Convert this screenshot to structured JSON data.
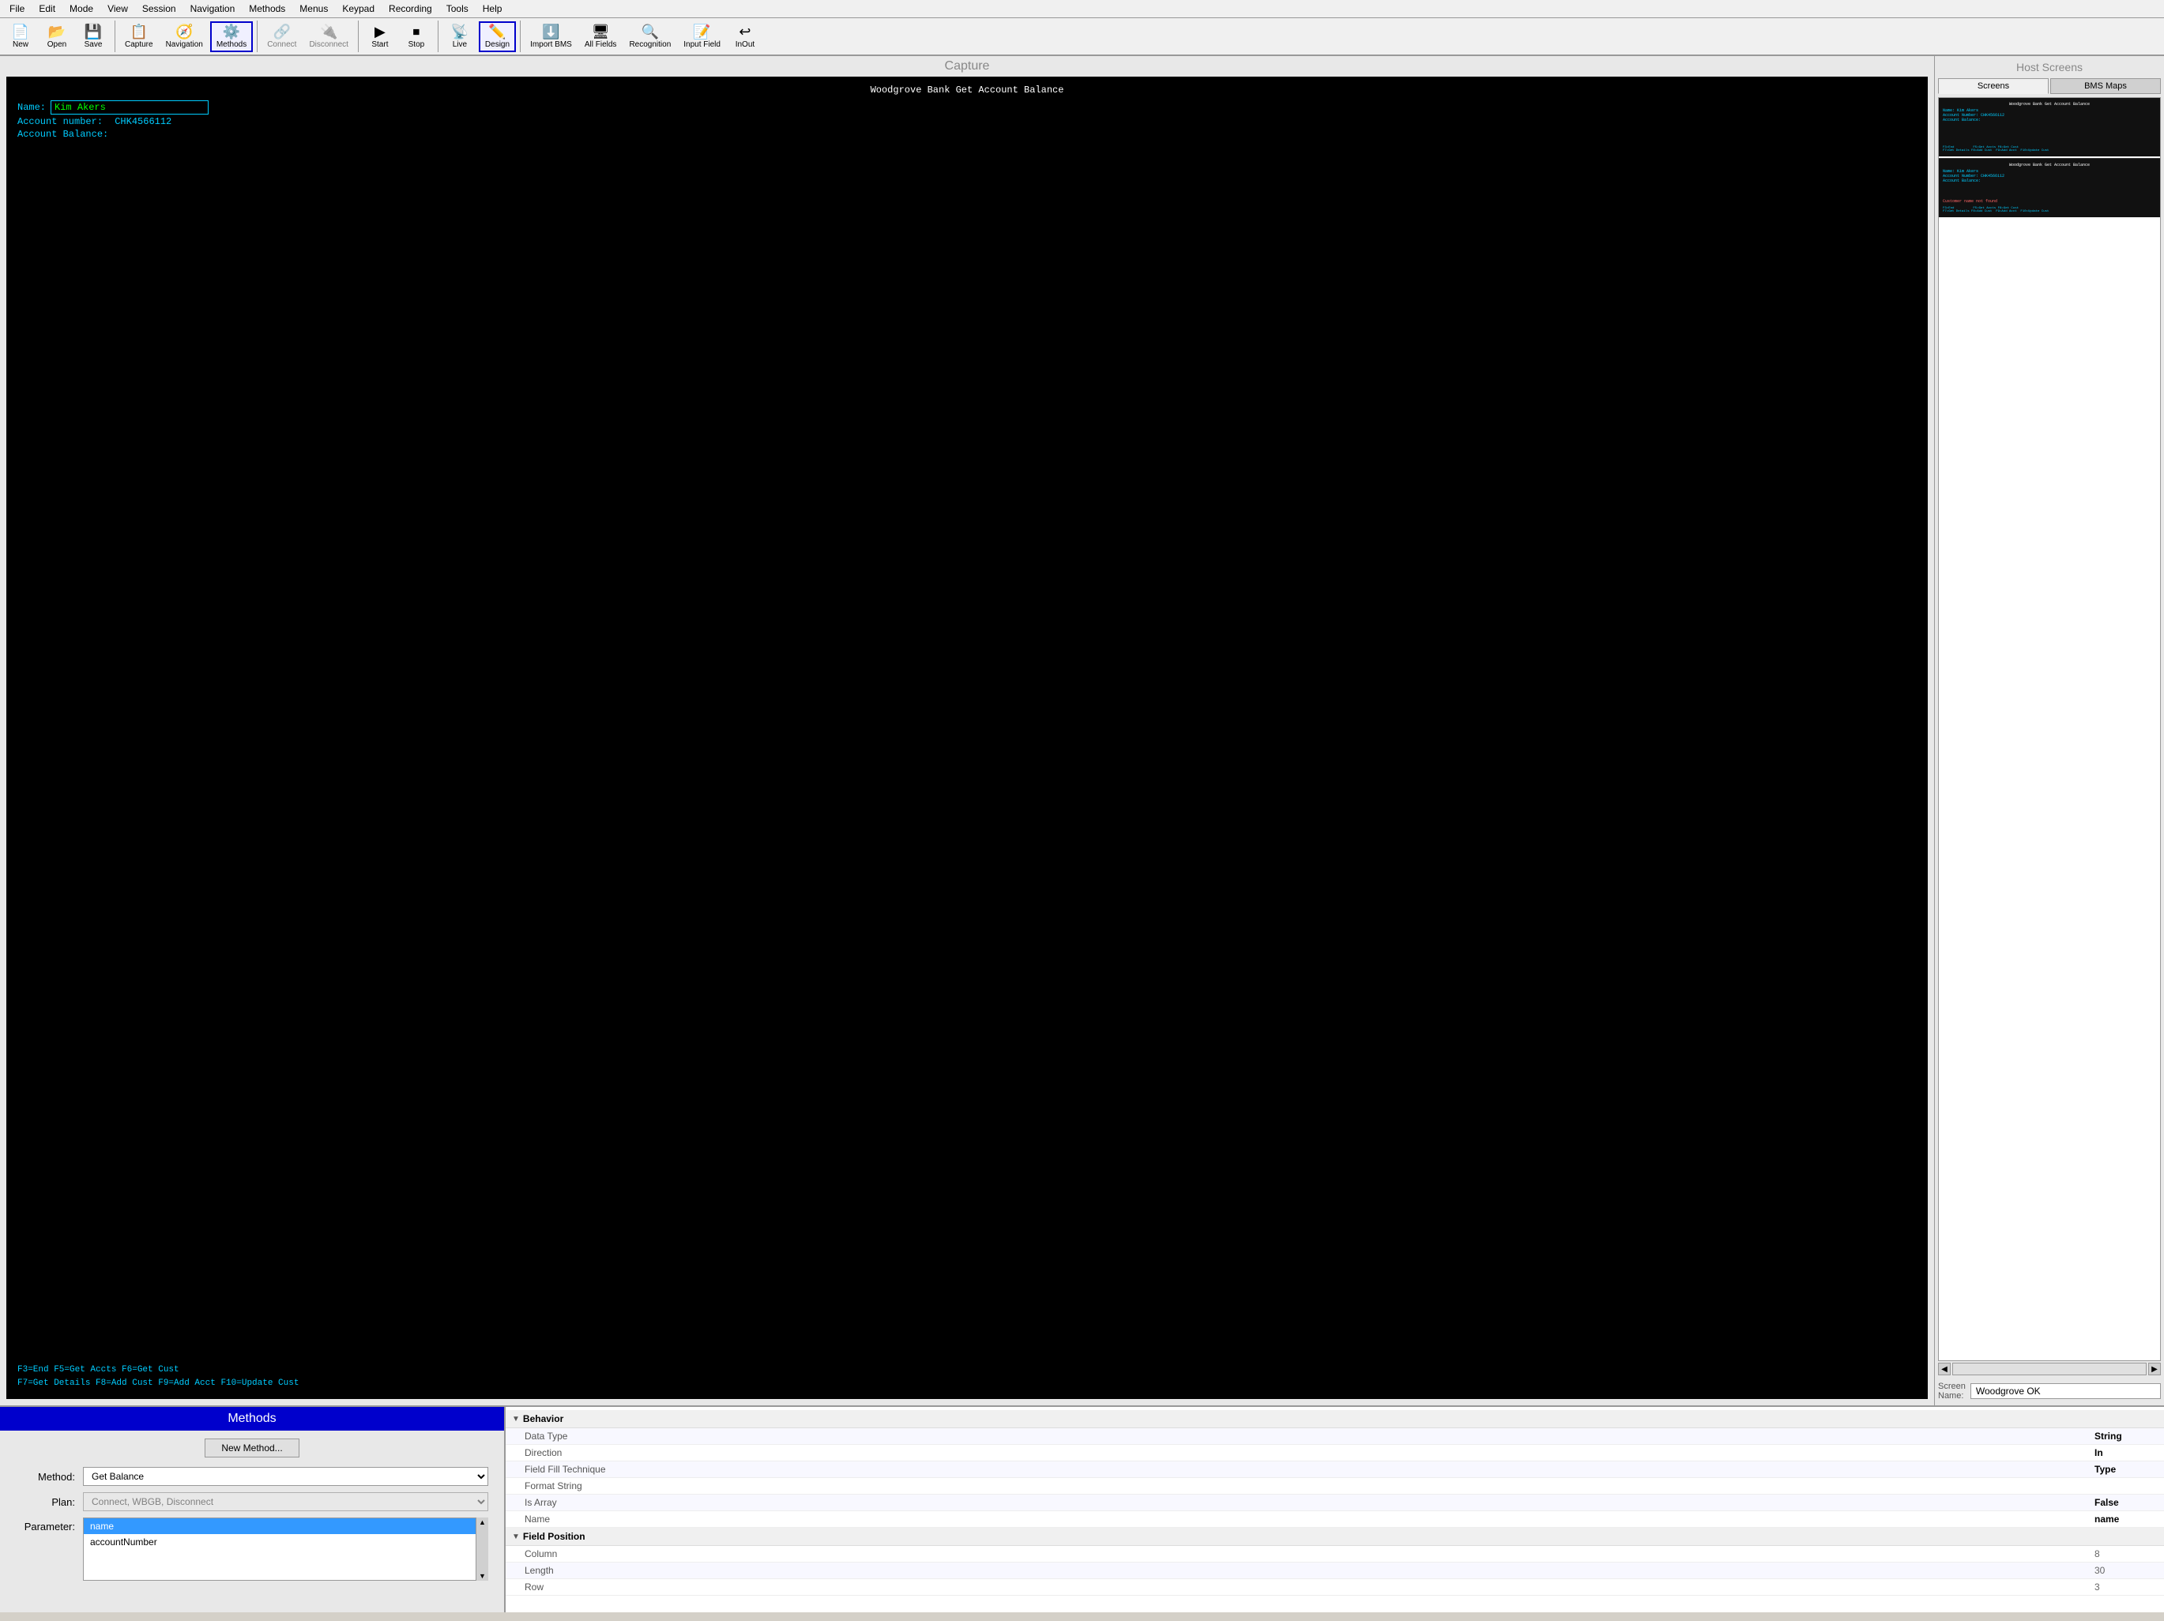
{
  "menubar": {
    "items": [
      "File",
      "Edit",
      "Mode",
      "View",
      "Session",
      "Navigation",
      "Methods",
      "Menus",
      "Keypad",
      "Recording",
      "Tools",
      "Help"
    ]
  },
  "toolbar": {
    "buttons": [
      {
        "id": "new",
        "label": "New",
        "icon": "📄"
      },
      {
        "id": "open",
        "label": "Open",
        "icon": "📂"
      },
      {
        "id": "save",
        "label": "Save",
        "icon": "💾"
      },
      {
        "id": "capture",
        "label": "Capture",
        "icon": "📋"
      },
      {
        "id": "navigation",
        "label": "Navigation",
        "icon": "🧭"
      },
      {
        "id": "methods",
        "label": "Methods",
        "icon": "⚙️",
        "active": true
      },
      {
        "id": "connect",
        "label": "Connect",
        "icon": "🔌",
        "disabled": true
      },
      {
        "id": "disconnect",
        "label": "Disconnect",
        "icon": "🔌",
        "disabled": true
      },
      {
        "id": "start",
        "label": "Start",
        "icon": "▶"
      },
      {
        "id": "stop",
        "label": "Stop",
        "icon": "⏹"
      },
      {
        "id": "live",
        "label": "Live",
        "icon": "📡"
      },
      {
        "id": "design",
        "label": "Design",
        "icon": "✏️",
        "active": true
      },
      {
        "id": "import-bms",
        "label": "Import BMS",
        "icon": "⬇️"
      },
      {
        "id": "all-fields",
        "label": "All Fields",
        "icon": "🖥"
      },
      {
        "id": "recognition",
        "label": "Recognition",
        "icon": "🔍"
      },
      {
        "id": "input-field",
        "label": "Input Field",
        "icon": "📝"
      },
      {
        "id": "inout",
        "label": "InOut",
        "icon": "↩"
      }
    ]
  },
  "capture": {
    "title": "Capture",
    "terminal": {
      "title": "Woodgrove Bank Get Account Balance",
      "name_label": "Name:",
      "name_value": "Kim Akers",
      "account_number_label": "Account number:",
      "account_number_value": "CHK4566112",
      "account_balance_label": "Account Balance:",
      "fkeys_line1": "F3=End                    F5=Get Accts  F6=Get Cust",
      "fkeys_line2": "F7=Get Details  F8=Add Cust     F9=Add Acct   F10=Update Cust"
    }
  },
  "host_screens": {
    "title": "Host Screens",
    "tabs": [
      "Screens",
      "BMS Maps"
    ],
    "active_tab": "Screens",
    "screen1": {
      "title": "Woodgrove Bank Get Account Balance",
      "lines": [
        "Name:  Kim Akers",
        "Account Number: CHK4566112",
        "Account Balance:"
      ],
      "fkeys": "F3=End          F5=Get Accts F6=Get Cust\nF7=Get Details F8=Add Cust  F9=Add Acct  F10=Update Cust"
    },
    "screen2": {
      "title": "Woodgrove Bank Get Account Balance",
      "lines": [
        "Name:  Kim Akers",
        "Account Number: CHK4566112",
        "Account Balance:"
      ],
      "error": "Customer name not found",
      "fkeys": "F3=End          F5=Get Accts F6=Get Cust\nF7=Get Details F8=Add Cust  F9=Add Acct  F10=Update Cust"
    },
    "screen_name_label": "Screen\nName:",
    "screen_name_value": "Woodgrove OK"
  },
  "methods": {
    "title": "Methods",
    "new_method_btn": "New Method...",
    "method_label": "Method:",
    "method_value": "Get Balance",
    "plan_label": "Plan:",
    "plan_value": "Connect, WBGB, Disconnect",
    "parameter_label": "Parameter:",
    "parameters": [
      {
        "name": "name",
        "selected": true
      },
      {
        "name": "accountNumber",
        "selected": false
      }
    ]
  },
  "properties": {
    "behavior_section": "Behavior",
    "rows_behavior": [
      {
        "name": "Data Type",
        "value": "String",
        "bold": true
      },
      {
        "name": "Direction",
        "value": "In",
        "bold": true
      },
      {
        "name": "Field Fill Technique",
        "value": "Type",
        "bold": true
      },
      {
        "name": "Format String",
        "value": "",
        "bold": false
      },
      {
        "name": "Is Array",
        "value": "False",
        "bold": true
      },
      {
        "name": "Name",
        "value": "name",
        "bold": true
      }
    ],
    "field_position_section": "Field Position",
    "rows_position": [
      {
        "name": "Column",
        "value": "8",
        "bold": false
      },
      {
        "name": "Length",
        "value": "30",
        "bold": false
      },
      {
        "name": "Row",
        "value": "3",
        "bold": false
      }
    ]
  }
}
